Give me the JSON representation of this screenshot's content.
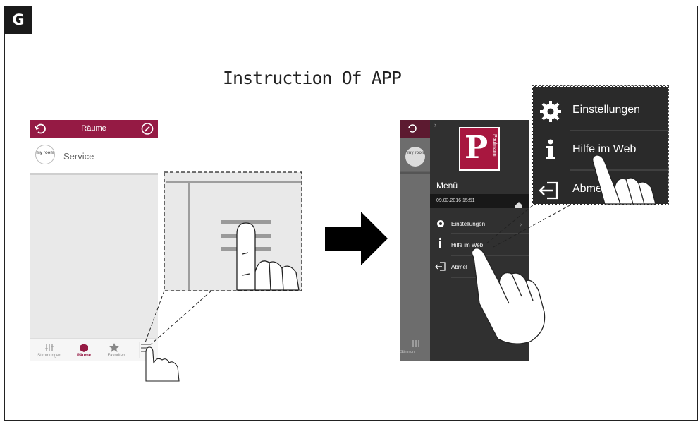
{
  "figure": {
    "label": "G",
    "title": "Instruction Of APP"
  },
  "left_phone": {
    "header_title": "Räume",
    "service_logo": "my room",
    "service_label": "Service",
    "nav": [
      {
        "label": "Stimmungen",
        "icon": "sliders-icon"
      },
      {
        "label": "Räume",
        "icon": "room-icon"
      },
      {
        "label": "Favoriten",
        "icon": "star-icon"
      }
    ],
    "accent_color": "#951a44"
  },
  "right_phone": {
    "brand_letter": "P",
    "brand_name": "Paulmann",
    "menu_title": "Menü",
    "datetime": "09.03.2016 15:51",
    "items": [
      {
        "label": "Einstellungen",
        "icon": "gear-icon"
      },
      {
        "label": "Hilfe im Web",
        "icon": "info-icon"
      },
      {
        "label": "Abmelden",
        "icon": "logout-icon"
      }
    ],
    "partial_labels": {
      "abmelden_cut": "Abmel",
      "nav_cut": "Stimmun"
    },
    "brand_color": "#a8173f"
  },
  "zoom_menu": {
    "items": [
      {
        "label": "Einstellungen",
        "icon": "gear-icon"
      },
      {
        "label": "Hilfe im Web",
        "icon": "info-icon"
      },
      {
        "label": "Abme",
        "icon": "logout-icon"
      }
    ]
  }
}
